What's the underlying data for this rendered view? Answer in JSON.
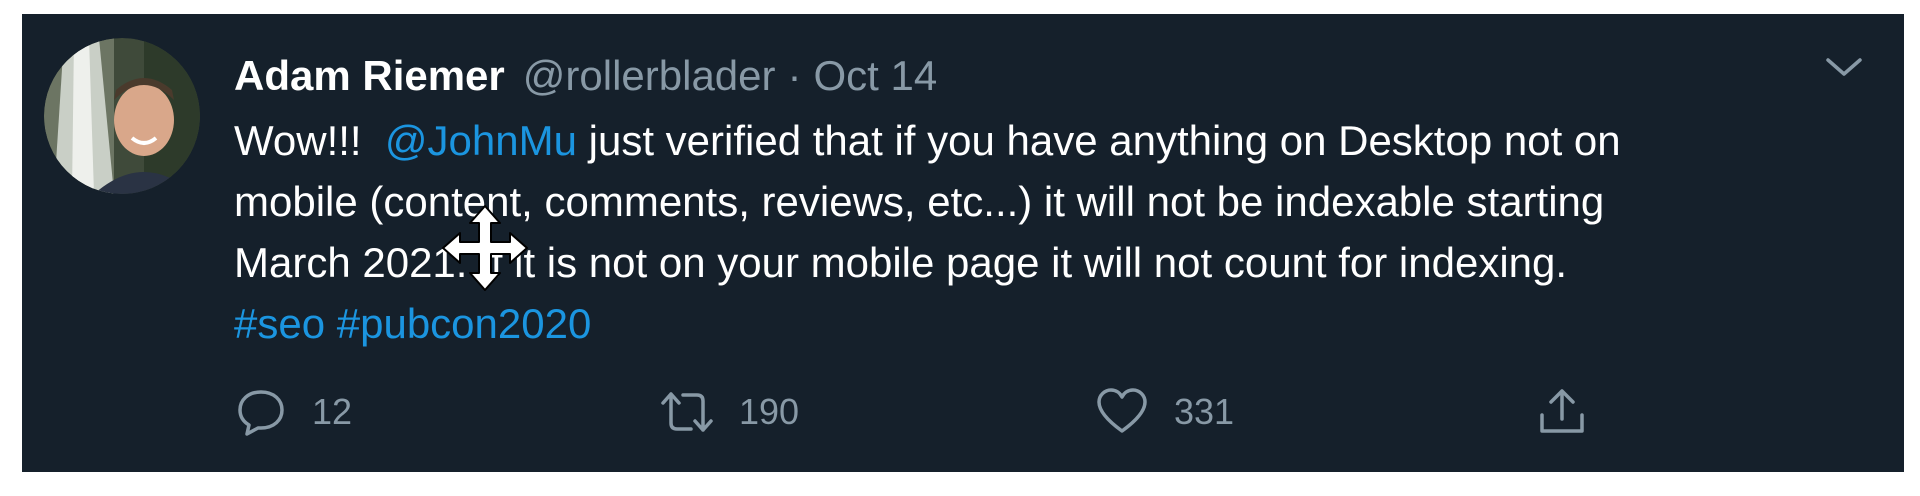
{
  "tweet": {
    "author_name": "Adam Riemer",
    "handle": "@rollerblader",
    "separator": "·",
    "date": "Oct 14",
    "text": {
      "line1_pre": "Wow!!!  ",
      "line1_mention": "@JohnMu",
      "line1_post": " just verified that if you have anything on Desktop not on",
      "line2": "mobile (content, comments, reviews, etc...) it will not be indexable starting",
      "line3": "March 2021. If it is not on your mobile page it will not count for indexing.",
      "hashtag1": "#seo",
      "hashtag2": "#pubcon2020"
    },
    "actions": {
      "reply_count": "12",
      "retweet_count": "190",
      "like_count": "331"
    }
  },
  "icons": [
    "avatar",
    "chevron-down-icon",
    "reply-icon",
    "retweet-icon",
    "like-icon",
    "share-icon",
    "move-cursor-icon"
  ],
  "colors": {
    "background": "#15202b",
    "text": "#ffffff",
    "muted": "#8899a6",
    "link": "#1b95e0"
  }
}
